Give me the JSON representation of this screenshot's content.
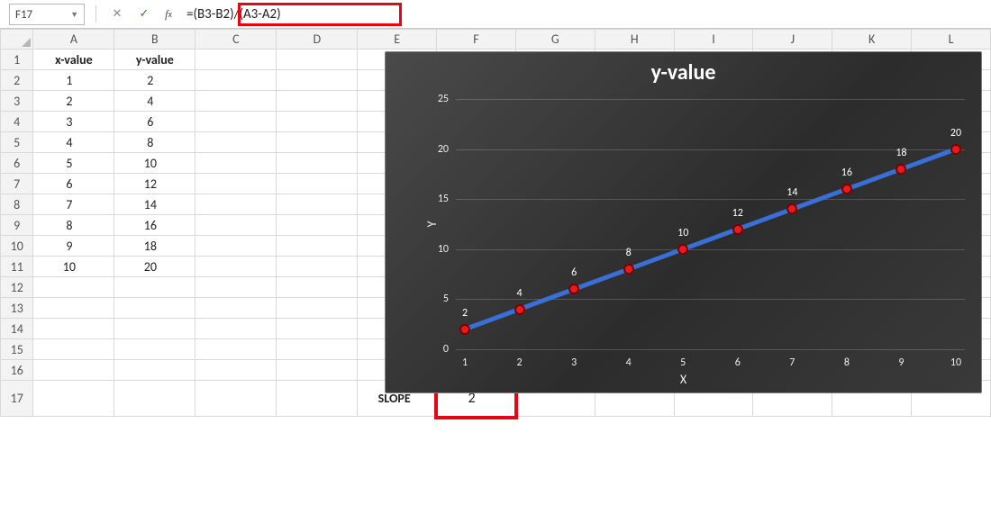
{
  "formula_bar": {
    "cell_ref": "F17",
    "formula": "=(B3-B2)/(A3-A2)"
  },
  "columns": [
    "A",
    "B",
    "C",
    "D",
    "E",
    "F",
    "G",
    "H",
    "I",
    "J",
    "K",
    "L"
  ],
  "rows": [
    "1",
    "2",
    "3",
    "4",
    "5",
    "6",
    "7",
    "8",
    "9",
    "10",
    "11",
    "12",
    "13",
    "14",
    "15",
    "16",
    "17"
  ],
  "headers": {
    "A1": "x-value",
    "B1": "y-value"
  },
  "data": {
    "x": [
      1,
      2,
      3,
      4,
      5,
      6,
      7,
      8,
      9,
      10
    ],
    "y": [
      2,
      4,
      6,
      8,
      10,
      12,
      14,
      16,
      18,
      20
    ]
  },
  "slope": {
    "label": "SLOPE",
    "value": 2
  },
  "active_column": "F",
  "hint_row": "8",
  "chart_data": {
    "type": "scatter",
    "title": "y-value",
    "xlabel": "X",
    "ylabel": "Y",
    "x": [
      1,
      2,
      3,
      4,
      5,
      6,
      7,
      8,
      9,
      10
    ],
    "y": [
      2,
      4,
      6,
      8,
      10,
      12,
      14,
      16,
      18,
      20
    ],
    "data_labels": [
      2,
      4,
      6,
      8,
      10,
      12,
      14,
      16,
      18,
      20
    ],
    "x_ticks": [
      1,
      2,
      3,
      4,
      5,
      6,
      7,
      8,
      9,
      10
    ],
    "y_ticks": [
      0,
      5,
      10,
      15,
      20,
      25
    ],
    "ylim": [
      0,
      25
    ],
    "xlim": [
      1,
      10
    ],
    "trendline": true,
    "marker_color": "#e61b1b",
    "line_color": "#3a6fd8"
  }
}
